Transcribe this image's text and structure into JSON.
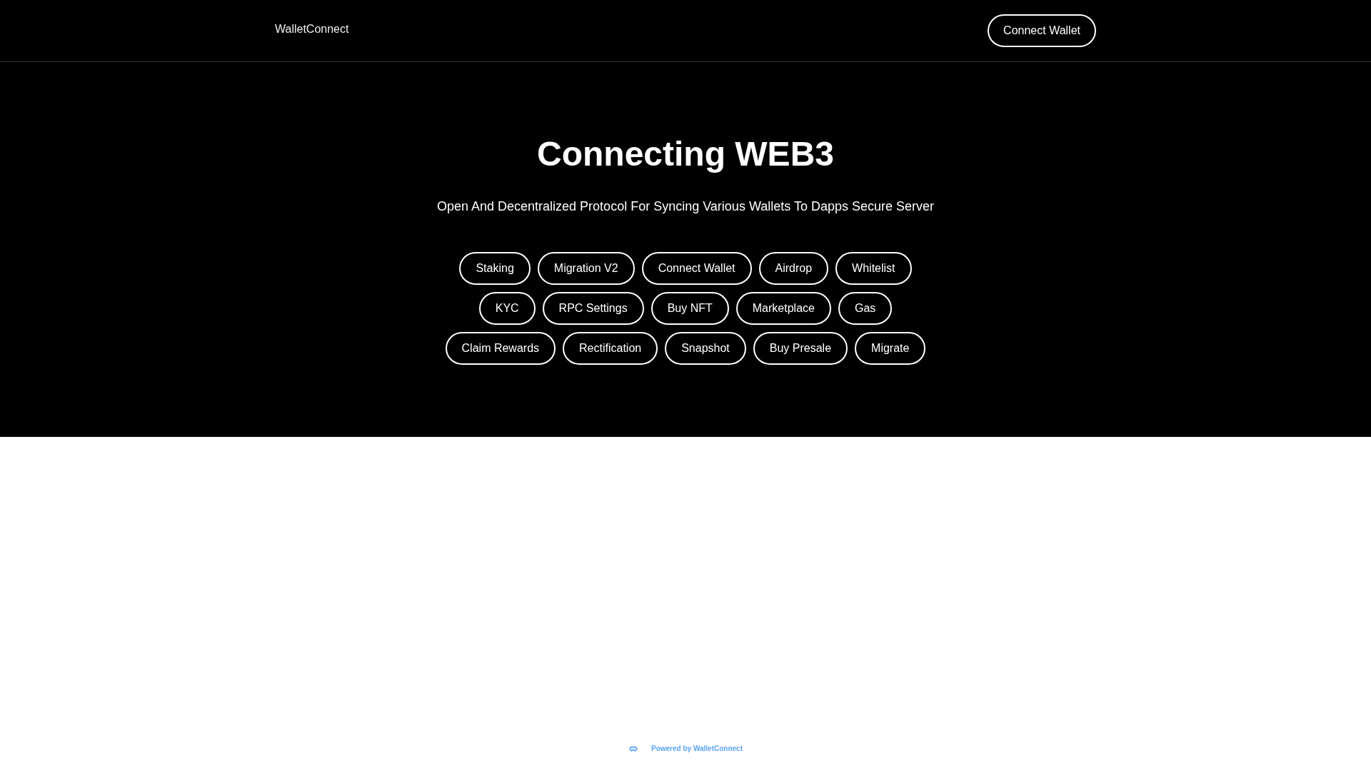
{
  "header": {
    "logo": "WalletConnect",
    "button": "Connect Wallet"
  },
  "hero": {
    "title": "Connecting WEB3",
    "subtitle": "Open And Decentralized Protocol For Syncing Various Wallets To Dapps Secure Server",
    "actions": [
      "Staking",
      "Migration V2",
      "Connect Wallet",
      "Airdrop",
      "Whitelist",
      "KYC",
      "RPC Settings",
      "Buy NFT",
      "Marketplace",
      "Gas",
      "Claim Rewards",
      "Rectification",
      "Snapshot",
      "Buy Presale",
      "Migrate"
    ]
  },
  "footer": {
    "text": "Powered by WalletConnect"
  }
}
